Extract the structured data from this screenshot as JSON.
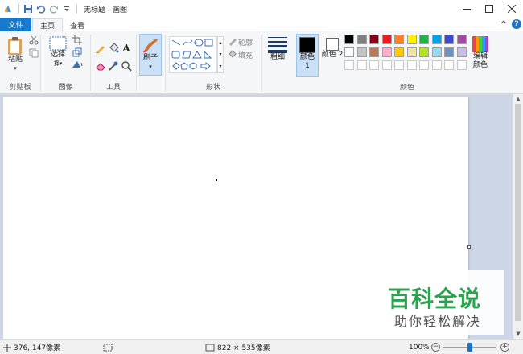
{
  "window": {
    "title": "无标题 - 画图"
  },
  "tabs": {
    "file": "文件",
    "home": "主页",
    "view": "查看"
  },
  "ribbon": {
    "clipboard": {
      "paste": "粘贴",
      "label": "剪贴板"
    },
    "image": {
      "select": "选择",
      "label": "图像"
    },
    "tools": {
      "label": "工具"
    },
    "brushes": {
      "label": "刷子"
    },
    "shapes": {
      "outline": "轮廓",
      "fill": "填充",
      "label": "形状"
    },
    "size": {
      "label": "粗细"
    },
    "color1": {
      "label": "颜色 1",
      "color": "#000000"
    },
    "color2": {
      "label": "颜色 2",
      "color": "#ffffff"
    },
    "colors": {
      "label": "颜色",
      "edit": "编辑颜色",
      "row1": [
        "#000000",
        "#7f7f7f",
        "#880015",
        "#ed1c24",
        "#ff7f27",
        "#fff200",
        "#22b14c",
        "#00a2e8",
        "#3f48cc",
        "#a349a4"
      ],
      "row2": [
        "#ffffff",
        "#c3c3c3",
        "#b97a57",
        "#ffaec9",
        "#ffc90e",
        "#efe4b0",
        "#b5e61d",
        "#99d9ea",
        "#7092be",
        "#c8bfe7"
      ]
    }
  },
  "status": {
    "cursor_pos": "376, 147像素",
    "canvas_size": "822 × 535像素",
    "zoom": "100%",
    "zoom_out": "−",
    "zoom_in": "+"
  },
  "watermark": {
    "title": "百科全说",
    "subtitle": "助你轻松解决"
  }
}
